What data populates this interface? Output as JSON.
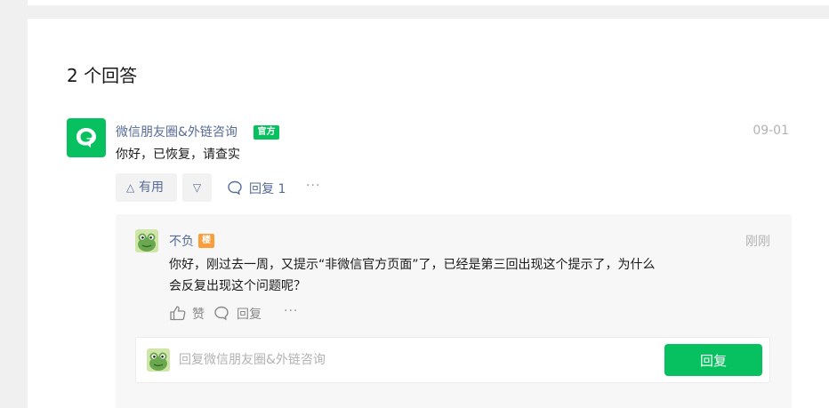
{
  "answers": {
    "title": "2 个回答"
  },
  "answer": {
    "author": "微信朋友圈&外链咨询",
    "badge": "官方",
    "date": "09-01",
    "content": "你好，已恢复，请查实",
    "actions": {
      "like_label": "有用",
      "reply_label": "回复 1",
      "more": "···"
    }
  },
  "sub_reply": {
    "author": "不负",
    "badge": "楼",
    "time": "刚刚",
    "content": "你好，刚过去一周，又提示“非微信官方页面”了，已经是第三回出现这个提示了，为什么会反复出现这个问题呢？",
    "actions": {
      "like_label": "赞",
      "reply_label": "回复",
      "more": "···"
    }
  },
  "reply_box": {
    "placeholder": "回复微信朋友圈&外链咨询",
    "submit_label": "回复"
  },
  "colors": {
    "brand_green": "#07c160",
    "link_blue": "#576b95",
    "floor_orange": "#fa9d3b"
  }
}
